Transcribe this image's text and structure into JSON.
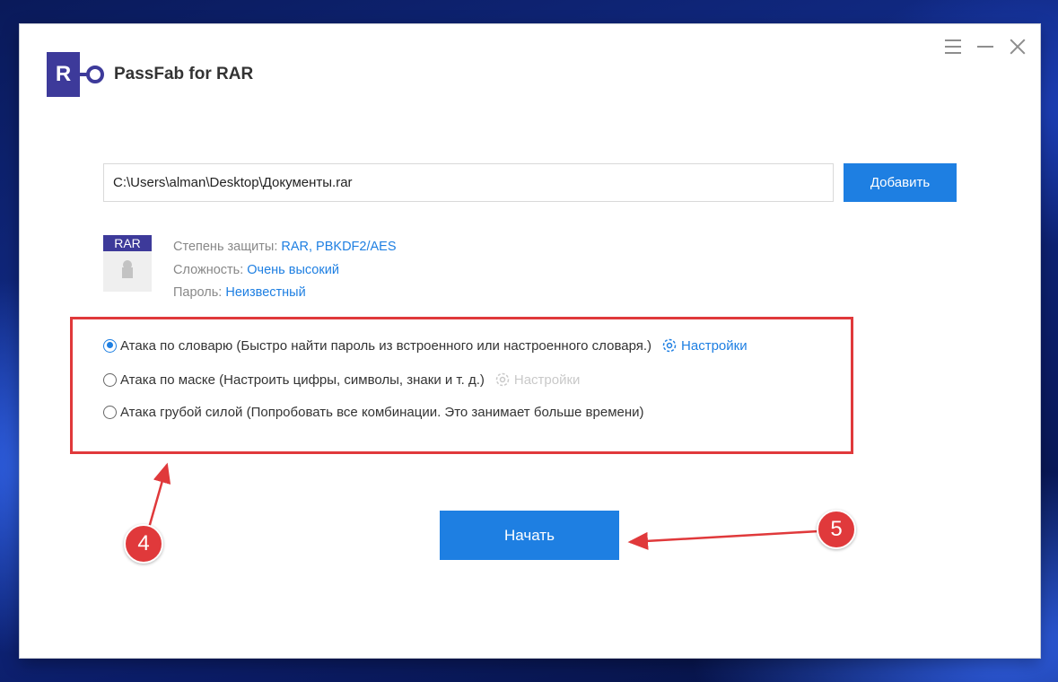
{
  "app": {
    "logo_letter": "R",
    "title": "PassFab for RAR"
  },
  "window_controls": [
    "menu-icon",
    "minimize-icon",
    "close-icon"
  ],
  "file": {
    "path": "C:\\Users\\alman\\Desktop\\Документы.rar",
    "add_button": "Добавить",
    "icon_label": "RAR",
    "info": [
      {
        "key": "Степень защиты: ",
        "value": "RAR, PBKDF2/AES"
      },
      {
        "key": "Сложность: ",
        "value": "Очень высокий"
      },
      {
        "key": "Пароль: ",
        "value": "Неизвестный"
      }
    ]
  },
  "attacks": [
    {
      "label": "Атака по словарю (Быстро найти пароль из встроенного или настроенного словаря.)",
      "selected": true,
      "settings": "Настройки",
      "settings_enabled": true
    },
    {
      "label": "Атака по маске (Настроить цифры, символы, знаки и т. д.)",
      "selected": false,
      "settings": "Настройки",
      "settings_enabled": false
    },
    {
      "label": "Атака грубой силой (Попробовать все комбинации. Это занимает больше времени)",
      "selected": false
    }
  ],
  "start_button": "Начать",
  "annotations": {
    "badge_4": "4",
    "badge_5": "5",
    "color": "#e0393b"
  },
  "colors": {
    "accent": "#1e7fe2",
    "brand": "#3d3a9a",
    "highlight": "#e0393b"
  }
}
